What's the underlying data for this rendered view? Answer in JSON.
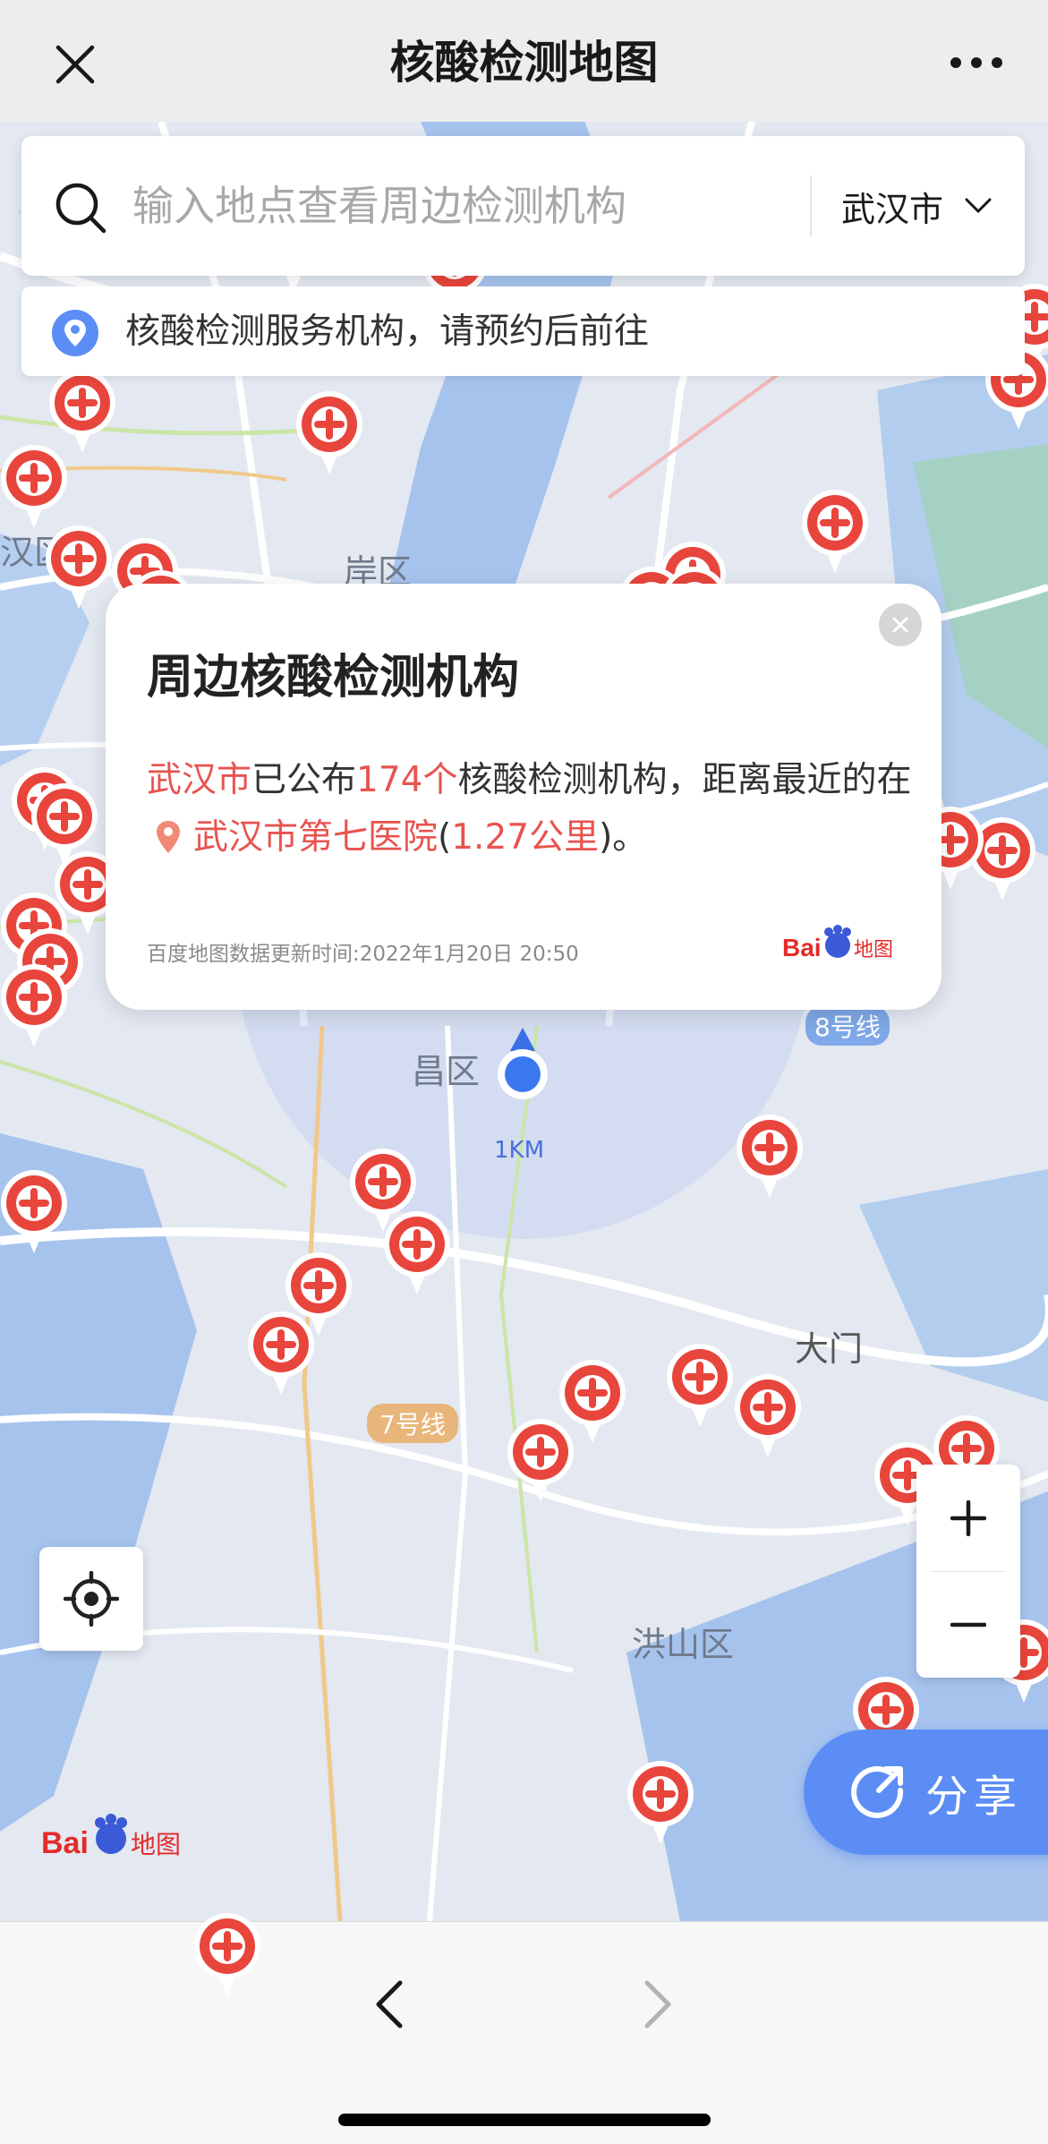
{
  "header": {
    "title": "核酸检测地图"
  },
  "search": {
    "placeholder": "输入地点查看周边检测机构",
    "city": "武汉市"
  },
  "notice": {
    "text": "核酸检测服务机构，请预约后前往"
  },
  "popup": {
    "title": "周边核酸检测机构",
    "city": "武汉市",
    "text_published": "已公布",
    "count": "174个",
    "text_mid": "核酸检测机构，距离最近的在",
    "nearest": "武汉市第七医院",
    "paren_open": "(",
    "distance": "1.27公里",
    "paren_close": ")。",
    "footnote": "百度地图数据更新时间:2022年1月20日 20:50",
    "logo": "Baidu地图"
  },
  "map": {
    "labels": {
      "district_left": "汉区",
      "district_an": "岸区",
      "district_chang": "昌区",
      "scale": "1KM",
      "metro_3": "8号线",
      "metro_7": "7号线",
      "damen": "大门",
      "hongshan": "洪山区"
    },
    "logo": "Baidu地图"
  },
  "controls": {
    "zoom_in": "+",
    "zoom_out": "−",
    "share": "分享"
  },
  "colors": {
    "pin": "#e8453c",
    "accent": "#5b8df5",
    "water": "#a6c3ee",
    "land": "#e3e8f1"
  }
}
